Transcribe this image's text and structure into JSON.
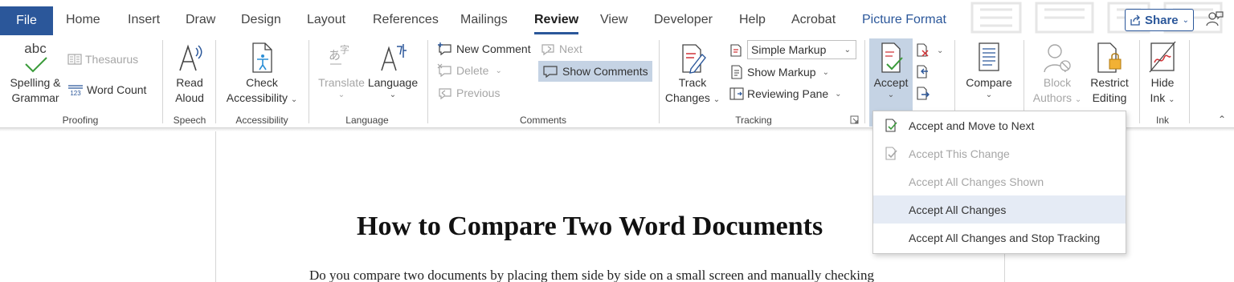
{
  "tabs": {
    "file": "File",
    "items": [
      "Home",
      "Insert",
      "Draw",
      "Design",
      "Layout",
      "References",
      "Mailings",
      "Review",
      "View",
      "Developer",
      "Help",
      "Acrobat",
      "Picture Format"
    ],
    "active": "Review",
    "share_label": "Share"
  },
  "ribbon": {
    "proofing": {
      "spelling_label": "Spelling &",
      "spelling_label2": "Grammar",
      "thesaurus_label": "Thesaurus",
      "word_count_label": "Word Count",
      "group_label": "Proofing",
      "word_count_digits": "123"
    },
    "speech": {
      "read_aloud_label": "Read",
      "read_aloud_label2": "Aloud",
      "group_label": "Speech"
    },
    "accessibility": {
      "check_label": "Check",
      "check_label2": "Accessibility",
      "group_label": "Accessibility"
    },
    "language": {
      "translate_label": "Translate",
      "language_label": "Language",
      "group_label": "Language"
    },
    "comments": {
      "new_comment_label": "New Comment",
      "delete_label": "Delete",
      "previous_label": "Previous",
      "next_label": "Next",
      "show_comments_label": "Show Comments",
      "group_label": "Comments"
    },
    "tracking": {
      "track_changes_label": "Track",
      "track_changes_label2": "Changes",
      "markup_select_value": "Simple Markup",
      "show_markup_label": "Show Markup",
      "reviewing_pane_label": "Reviewing Pane",
      "group_label": "Tracking"
    },
    "changes": {
      "accept_label": "Accept"
    },
    "compare": {
      "compare_label": "Compare"
    },
    "protect": {
      "block_authors_label": "Block",
      "block_authors_label2": "Authors",
      "restrict_editing_label": "Restrict",
      "restrict_editing_label2": "Editing"
    },
    "ink": {
      "hide_ink_label": "Hide",
      "hide_ink_label2": "Ink",
      "group_label": "Ink"
    }
  },
  "accept_menu": {
    "items": [
      {
        "label": "Accept and Move to Next",
        "enabled": true
      },
      {
        "label": "Accept This Change",
        "enabled": false
      },
      {
        "label": "Accept All Changes Shown",
        "enabled": false
      },
      {
        "label": "Accept All Changes",
        "enabled": true,
        "highlighted": true
      },
      {
        "label": "Accept All Changes and Stop Tracking",
        "enabled": true
      }
    ]
  },
  "document": {
    "title": "How to Compare Two Word Documents",
    "body_first_line": "Do you compare two documents by placing them side by side on a small screen and manually checking"
  },
  "colors": {
    "brand_blue": "#2b579a",
    "selected_button_bg": "#c5d3e4",
    "menu_hover_bg": "#e5ebf5",
    "check_green": "#3a9b3a",
    "reject_red": "#d13438"
  },
  "icons": [
    "spelling-check-icon",
    "thesaurus-icon",
    "word-count-icon",
    "read-aloud-icon",
    "check-accessibility-icon",
    "translate-icon",
    "language-icon",
    "new-comment-icon",
    "delete-comment-icon",
    "previous-comment-icon",
    "next-comment-icon",
    "show-comments-icon",
    "track-changes-icon",
    "markup-icon",
    "show-markup-icon",
    "reviewing-pane-icon",
    "accept-icon",
    "reject-icon",
    "previous-change-icon",
    "next-change-icon",
    "compare-icon",
    "block-authors-icon",
    "restrict-editing-icon",
    "hide-ink-icon",
    "share-icon",
    "comments-pane-icon",
    "collapse-ribbon-icon",
    "dialog-launcher-icon",
    "accept-move-next-icon",
    "accept-this-change-icon"
  ]
}
